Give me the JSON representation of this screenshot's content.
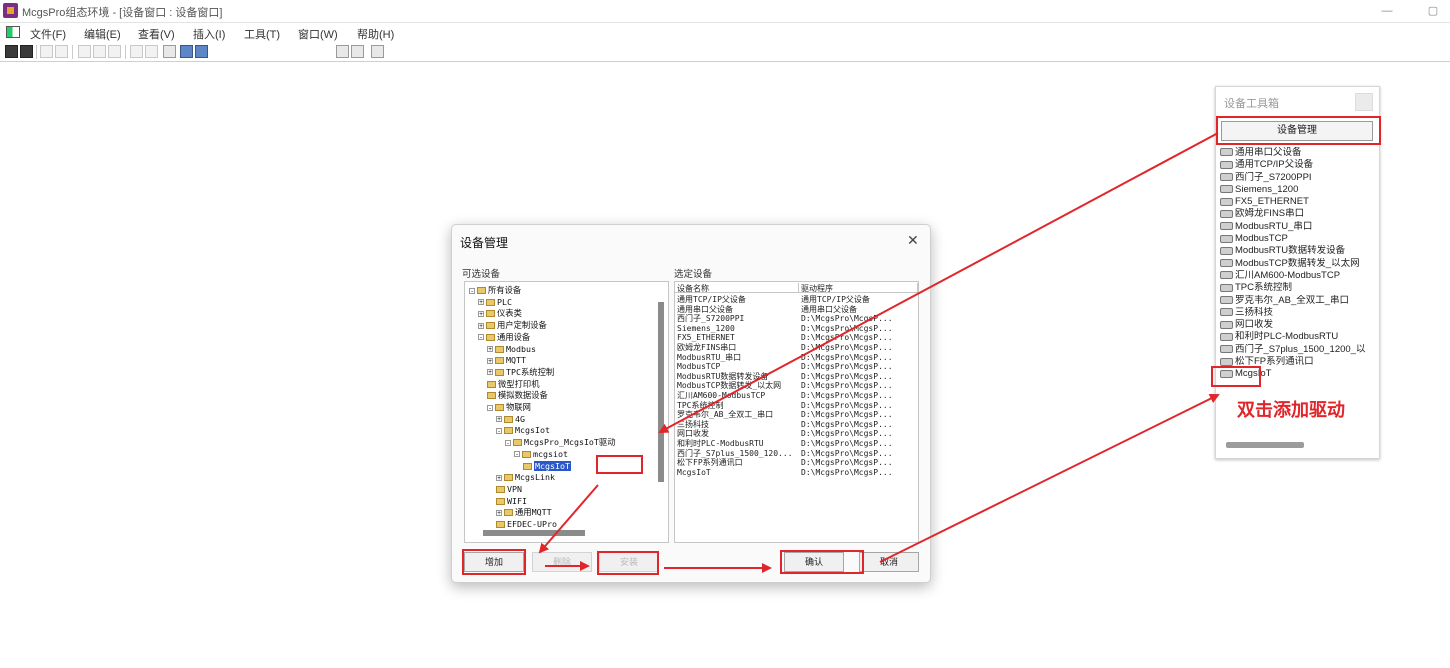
{
  "window": {
    "title": "McgsPro组态环境 - [设备窗口 : 设备窗口]",
    "minimize_glyph": "—",
    "restore_glyph": "▢"
  },
  "menu": [
    "文件(F)",
    "编辑(E)",
    "查看(V)",
    "插入(I)",
    "工具(T)",
    "窗口(W)",
    "帮助(H)"
  ],
  "toolbox": {
    "title": "设备工具箱",
    "manage_button": "设备管理",
    "items": [
      "通用串口父设备",
      "通用TCP/IP父设备",
      "西门子_S7200PPI",
      "Siemens_1200",
      "FX5_ETHERNET",
      "欧姆龙FINS串口",
      "ModbusRTU_串口",
      "ModbusTCP",
      "ModbusRTU数据转发设备",
      "ModbusTCP数据转发_以太网",
      "汇川AM600-ModbusTCP",
      "TPC系统控制",
      "罗克韦尔_AB_全双工_串口",
      "三扬科技",
      "网口收发",
      "和利时PLC-ModbusRTU",
      "西门子_S7plus_1500_1200_以",
      "松下FP系列通讯口",
      "McgsIoT"
    ]
  },
  "dialog": {
    "title": "设备管理",
    "close_glyph": "✕",
    "available_label": "可选设备",
    "selected_label": "选定设备",
    "tree": [
      {
        "label": "所有设备",
        "level": 0,
        "toggle": "-"
      },
      {
        "label": "PLC",
        "level": 1,
        "toggle": "+"
      },
      {
        "label": "仪表类",
        "level": 1,
        "toggle": "+"
      },
      {
        "label": "用户定制设备",
        "level": 1,
        "toggle": "+"
      },
      {
        "label": "通用设备",
        "level": 1,
        "toggle": "-"
      },
      {
        "label": "Modbus",
        "level": 2,
        "toggle": "+"
      },
      {
        "label": "MQTT",
        "level": 2,
        "toggle": "+"
      },
      {
        "label": "TPC系统控制",
        "level": 2,
        "toggle": "+"
      },
      {
        "label": "微型打印机",
        "level": 2,
        "toggle": ""
      },
      {
        "label": "模拟数据设备",
        "level": 2,
        "toggle": ""
      },
      {
        "label": "物联网",
        "level": 2,
        "toggle": "-"
      },
      {
        "label": "4G",
        "level": 3,
        "toggle": "+"
      },
      {
        "label": "McgsIot",
        "level": 3,
        "toggle": "-"
      },
      {
        "label": "McgsPro_McgsIoT驱动",
        "level": 4,
        "toggle": "-"
      },
      {
        "label": "mcgsiot",
        "level": 5,
        "toggle": "-"
      },
      {
        "label": "McgsIoT",
        "level": 6,
        "toggle": "",
        "selected": true
      },
      {
        "label": "McgsLink",
        "level": 3,
        "toggle": "+"
      },
      {
        "label": "VPN",
        "level": 3,
        "toggle": ""
      },
      {
        "label": "WIFI",
        "level": 3,
        "toggle": ""
      },
      {
        "label": "通用MQTT",
        "level": 3,
        "toggle": "+"
      },
      {
        "label": "EFDEC-UPro",
        "level": 3,
        "toggle": ""
      }
    ],
    "table_headers": [
      "设备名称",
      "驱动程序"
    ],
    "rows": [
      [
        "通用TCP/IP父设备",
        "通用TCP/IP父设备"
      ],
      [
        "通用串口父设备",
        "通用串口父设备"
      ],
      [
        "西门子_S7200PPI",
        "D:\\McgsPro\\McgsP..."
      ],
      [
        "Siemens_1200",
        "D:\\McgsPro\\McgsP..."
      ],
      [
        "FX5_ETHERNET",
        "D:\\McgsPro\\McgsP..."
      ],
      [
        "欧姆龙FINS串口",
        "D:\\McgsPro\\McgsP..."
      ],
      [
        "ModbusRTU_串口",
        "D:\\McgsPro\\McgsP..."
      ],
      [
        "ModbusTCP",
        "D:\\McgsPro\\McgsP..."
      ],
      [
        "ModbusRTU数据转发设备",
        "D:\\McgsPro\\McgsP..."
      ],
      [
        "ModbusTCP数据转发_以太网",
        "D:\\McgsPro\\McgsP..."
      ],
      [
        "汇川AM600-ModbusTCP",
        "D:\\McgsPro\\McgsP..."
      ],
      [
        "TPC系统控制",
        "D:\\McgsPro\\McgsP..."
      ],
      [
        "罗克韦尔_AB_全双工_串口",
        "D:\\McgsPro\\McgsP..."
      ],
      [
        "三扬科技",
        "D:\\McgsPro\\McgsP..."
      ],
      [
        "网口收发",
        "D:\\McgsPro\\McgsP..."
      ],
      [
        "和利时PLC-ModbusRTU",
        "D:\\McgsPro\\McgsP..."
      ],
      [
        "西门子_S7plus_1500_120...",
        "D:\\McgsPro\\McgsP..."
      ],
      [
        "松下FP系列通讯口",
        "D:\\McgsPro\\McgsP..."
      ],
      [
        "McgsIoT",
        "D:\\McgsPro\\McgsP..."
      ]
    ],
    "buttons": {
      "add": "增加",
      "remove": "删除",
      "install": "安装",
      "confirm": "确认",
      "cancel": "取消"
    }
  },
  "annotation": {
    "text": "双击添加驱动",
    "color": "#e0262a"
  }
}
